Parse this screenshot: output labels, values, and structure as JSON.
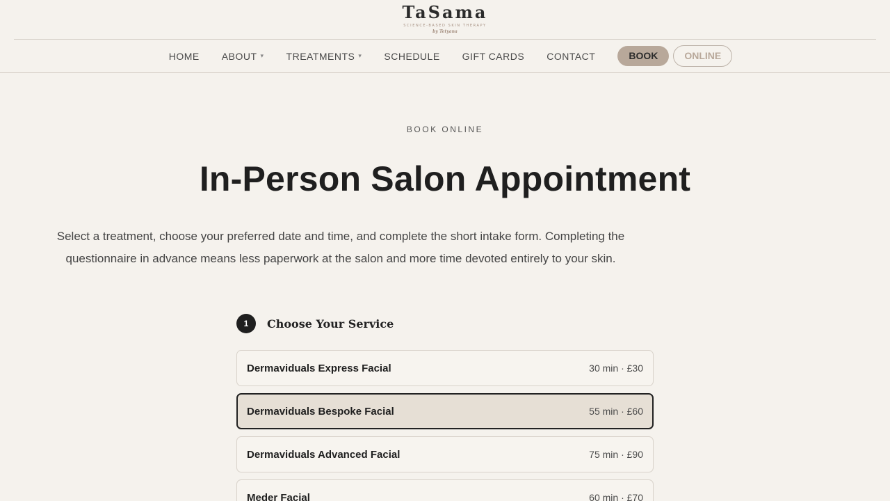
{
  "brand": {
    "name": "TaSama",
    "tagline": "SCIENCE-BASED SKIN THERAPY",
    "byline": "by Tetyana"
  },
  "nav": {
    "home": "HOME",
    "about": "ABOUT",
    "treatments": "TREATMENTS",
    "schedule": "SCHEDULE",
    "gift_cards": "GIFT CARDS",
    "contact": "CONTACT",
    "book": "BOOK",
    "online": "ONLINE",
    "caret": "▾"
  },
  "main": {
    "eyebrow": "BOOK ONLINE",
    "title": "In-Person Salon Appointment",
    "intro": "Select a treatment, choose your preferred date and time, and complete the short intake form. Completing the questionnaire in advance means less paperwork at the salon and more time devoted entirely to your skin.",
    "step": {
      "number": "1",
      "title": "Choose Your Service"
    },
    "services": [
      {
        "name": "Dermaviduals Express Facial",
        "meta": "30 min · £30",
        "selected": false
      },
      {
        "name": "Dermaviduals Bespoke Facial",
        "meta": "55 min · £60",
        "selected": true
      },
      {
        "name": "Dermaviduals Advanced Facial",
        "meta": "75 min · £90",
        "selected": false
      },
      {
        "name": "Meder Facial",
        "meta": "60 min · £70",
        "selected": false
      }
    ]
  },
  "colors": {
    "background": "#f5f2ed",
    "accent": "#b8a89a",
    "selected_bg": "#e6dfd5",
    "dark": "#1f1f1f"
  }
}
